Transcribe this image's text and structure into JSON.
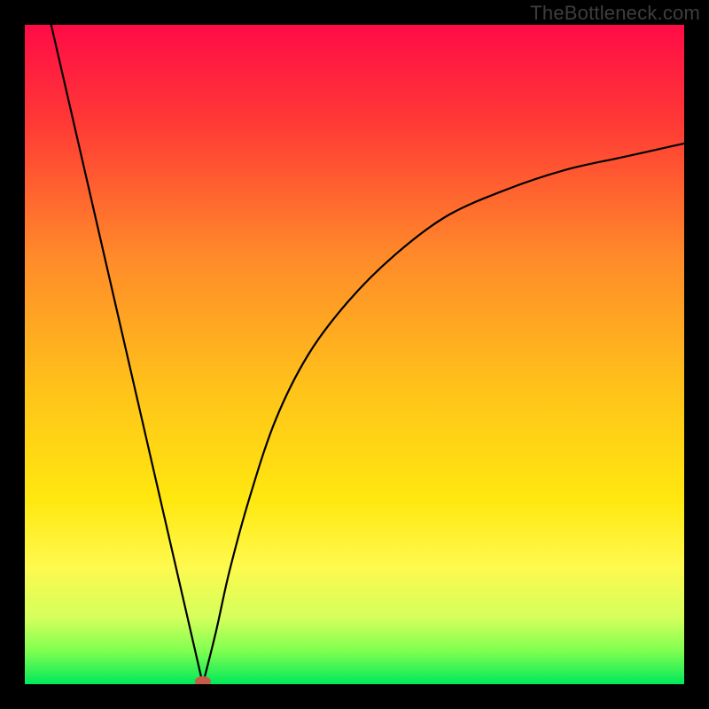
{
  "watermark": "TheBottleneck.com",
  "chart_data": {
    "type": "line",
    "title": "",
    "xlabel": "",
    "ylabel": "",
    "xlim": [
      0,
      100
    ],
    "ylim": [
      0,
      100
    ],
    "background_gradient": {
      "top_color": "#ff0b47",
      "mid_color": "#ffd400",
      "bottom_color": "#00e85a",
      "stops": [
        {
          "offset": 0,
          "color": "#ff0b47"
        },
        {
          "offset": 15,
          "color": "#ff3a35"
        },
        {
          "offset": 35,
          "color": "#ff8a2a"
        },
        {
          "offset": 55,
          "color": "#ffc21a"
        },
        {
          "offset": 72,
          "color": "#ffe80f"
        },
        {
          "offset": 82,
          "color": "#fff94d"
        },
        {
          "offset": 90,
          "color": "#d4ff5c"
        },
        {
          "offset": 95,
          "color": "#7fff50"
        },
        {
          "offset": 100,
          "color": "#00e85a"
        }
      ]
    },
    "curve": {
      "left_x0": 4,
      "left_y0": 100,
      "vertex_x": 27,
      "vertex_y": 0,
      "right_end_x": 100,
      "right_end_y": 82,
      "points_right": [
        {
          "x": 27,
          "y": 0
        },
        {
          "x": 29,
          "y": 8
        },
        {
          "x": 31,
          "y": 17
        },
        {
          "x": 34,
          "y": 28
        },
        {
          "x": 38,
          "y": 40
        },
        {
          "x": 43,
          "y": 50
        },
        {
          "x": 49,
          "y": 58
        },
        {
          "x": 56,
          "y": 65
        },
        {
          "x": 64,
          "y": 71
        },
        {
          "x": 73,
          "y": 75
        },
        {
          "x": 82,
          "y": 78
        },
        {
          "x": 91,
          "y": 80
        },
        {
          "x": 100,
          "y": 82
        }
      ]
    },
    "vertex_marker": {
      "x": 27,
      "y": 0,
      "color": "#c85a4a",
      "rx": 9,
      "ry": 6
    }
  }
}
